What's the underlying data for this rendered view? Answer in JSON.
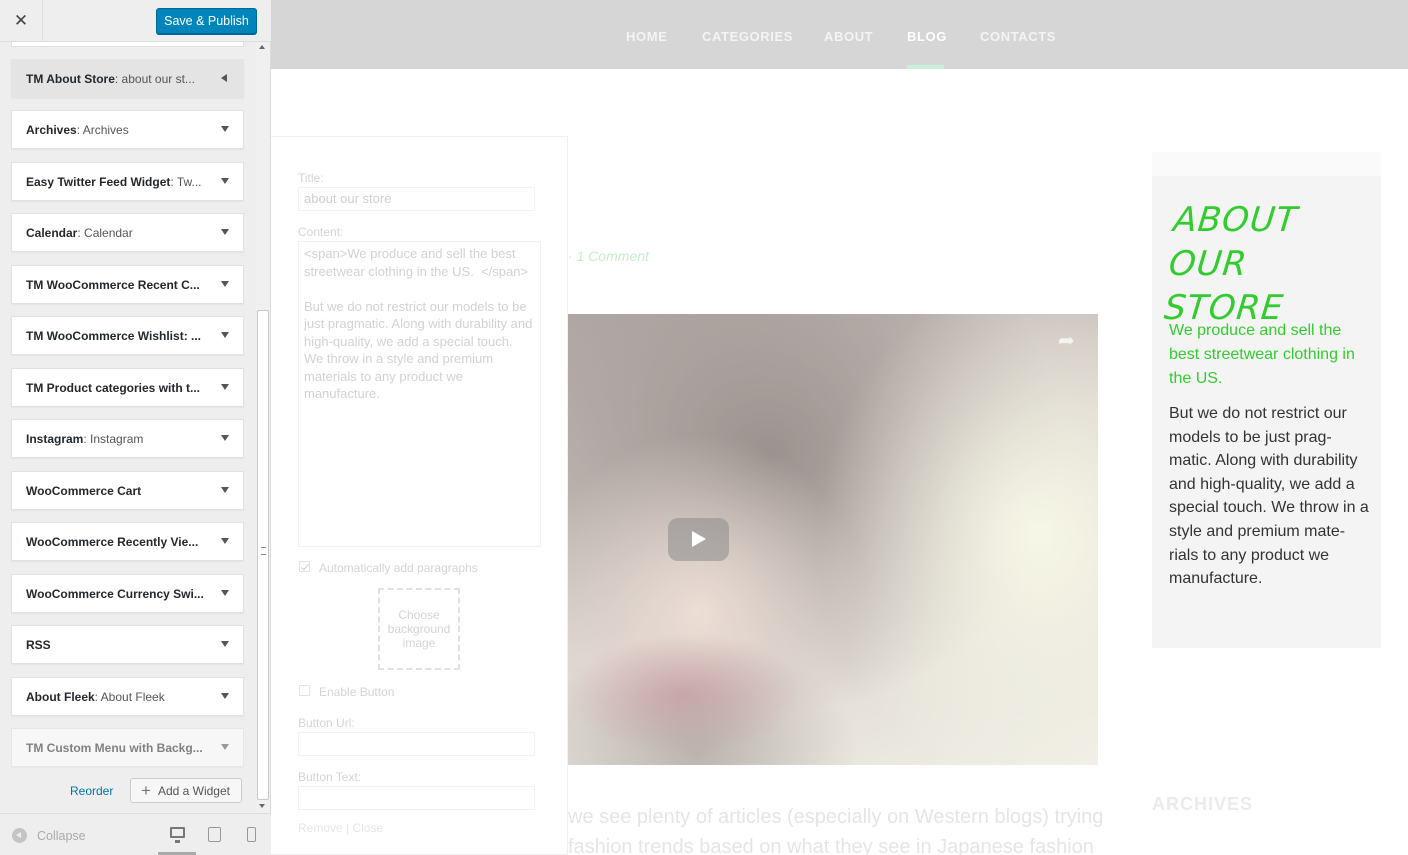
{
  "customizer": {
    "close_label": "✕",
    "publish_label": "Save & Publish",
    "widgets": [
      {
        "title": "TM About Store",
        "subtitle": ": about our st...",
        "expanded": true
      },
      {
        "title": "Archives",
        "subtitle": ": Archives"
      },
      {
        "title": "Easy Twitter Feed Widget",
        "subtitle": ": Tw..."
      },
      {
        "title": "Calendar",
        "subtitle": ": Calendar"
      },
      {
        "title": "TM WooCommerce Recent C...",
        "subtitle": ""
      },
      {
        "title": "TM WooCommerce Wishlist: ...",
        "subtitle": ""
      },
      {
        "title": "TM Product categories with t...",
        "subtitle": ""
      },
      {
        "title": "Instagram",
        "subtitle": ": Instagram"
      },
      {
        "title": "WooCommerce Cart",
        "subtitle": ""
      },
      {
        "title": "WooCommerce Recently Vie...",
        "subtitle": ""
      },
      {
        "title": "WooCommerce Currency Swi...",
        "subtitle": ""
      },
      {
        "title": "RSS",
        "subtitle": ""
      },
      {
        "title": "About Fleek",
        "subtitle": ": About Fleek"
      },
      {
        "title": "TM Custom Menu with Backg...",
        "subtitle": ""
      }
    ],
    "reorder_label": "Reorder",
    "add_widget_label": "Add a Widget",
    "add_widget_icon": "+",
    "collapse_label": "Collapse",
    "colors": {
      "primary_button": "#0085ba",
      "link": "#0073aa"
    }
  },
  "site": {
    "nav": {
      "items": [
        "HOME",
        "CATEGORIES",
        "ABOUT",
        "BLOG",
        "CONTACTS"
      ],
      "active": "BLOG"
    },
    "post": {
      "meta": "· 1 Comment",
      "article_text": "we see plenty of articles (especially on Western blogs) trying fashion trends based on what they see in Japanese fashion"
    },
    "widget_form": {
      "title_label": "Title:",
      "title_value": "about our store",
      "content_label": "Content:",
      "content_value": "<span>We produce and sell the best streetwear clothing in the US.  </span>\n\nBut we do not restrict our models to be just pragmatic. Along with durability and high-quality, we add a special touch. We throw in a style and premium materials to any product we manufacture.",
      "auto_paragraphs_label": "Automatically add paragraphs",
      "auto_paragraphs_checked": true,
      "bg_image_label": "Choose background image",
      "enable_button_label": "Enable Button",
      "enable_button_checked": false,
      "button_url_label": "Button Url:",
      "button_text_label": "Button Text:",
      "actions": "Remove | Close"
    },
    "about_widget": {
      "title": "ABOUT OUR STORE",
      "lead": "We produce and sell the best streetwear clothing in the US.",
      "body": "But we do not restrict our models to be just prag-matic. Along with durability and high-quality, we add a special touch. We throw in a style and premium mate-rials to any product we manufacture.",
      "accent_color": "#33cc2f"
    },
    "archives_heading": "ARCHIVES"
  }
}
